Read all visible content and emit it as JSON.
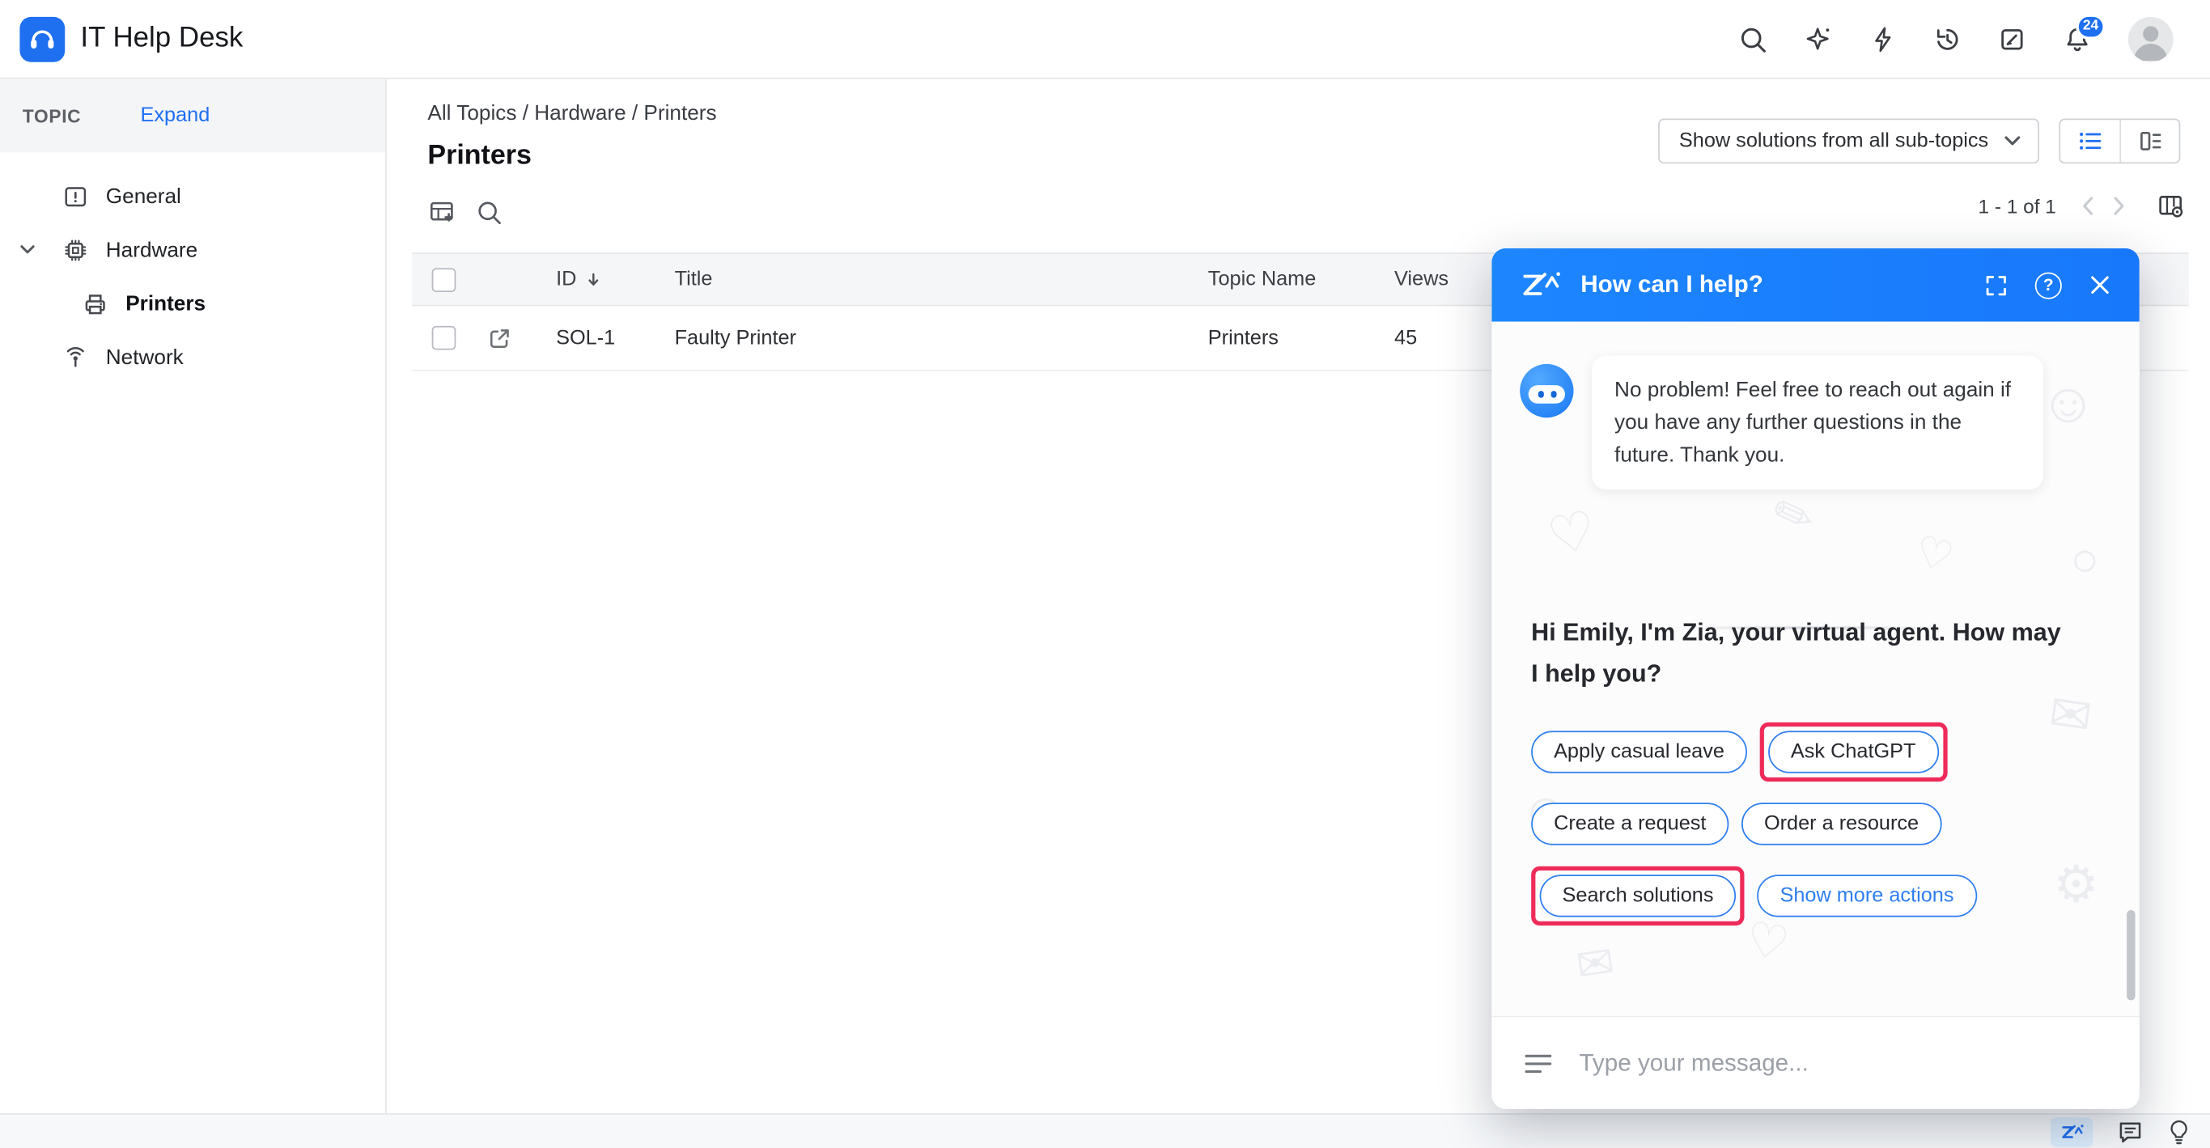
{
  "topbar": {
    "app_title": "IT Help Desk",
    "notification_count": "24"
  },
  "sidebar": {
    "section_label": "TOPIC",
    "expand_label": "Expand",
    "items": [
      {
        "label": "General"
      },
      {
        "label": "Hardware"
      },
      {
        "label": "Printers"
      },
      {
        "label": "Network"
      }
    ]
  },
  "main": {
    "breadcrumb": "All Topics / Hardware / Printers",
    "page_title": "Printers",
    "filter_dropdown_value": "Show solutions from all sub-topics",
    "pagination": "1 - 1 of 1",
    "table": {
      "headers": [
        "ID",
        "Title",
        "Topic Name",
        "Views"
      ],
      "rows": [
        {
          "id": "SOL-1",
          "title": "Faulty Printer",
          "topic": "Printers",
          "views": "45"
        }
      ]
    }
  },
  "chat": {
    "title": "How can I help?",
    "bot_message": "No problem! Feel free to reach out again if you have any further questions in the future. Thank you.",
    "greeting": "Hi Emily, I'm Zia, your virtual agent. How may I help you?",
    "actions": [
      "Apply casual leave",
      "Ask ChatGPT",
      "Create a request",
      "Order a resource",
      "Search solutions",
      "Show more actions"
    ],
    "input_placeholder": "Type your message..."
  },
  "colors": {
    "accent_blue": "#1f6ff1",
    "chat_header_blue": "#1e87ff",
    "chip_border_blue": "#2e7ef0",
    "highlight_red": "#ee2b59"
  }
}
